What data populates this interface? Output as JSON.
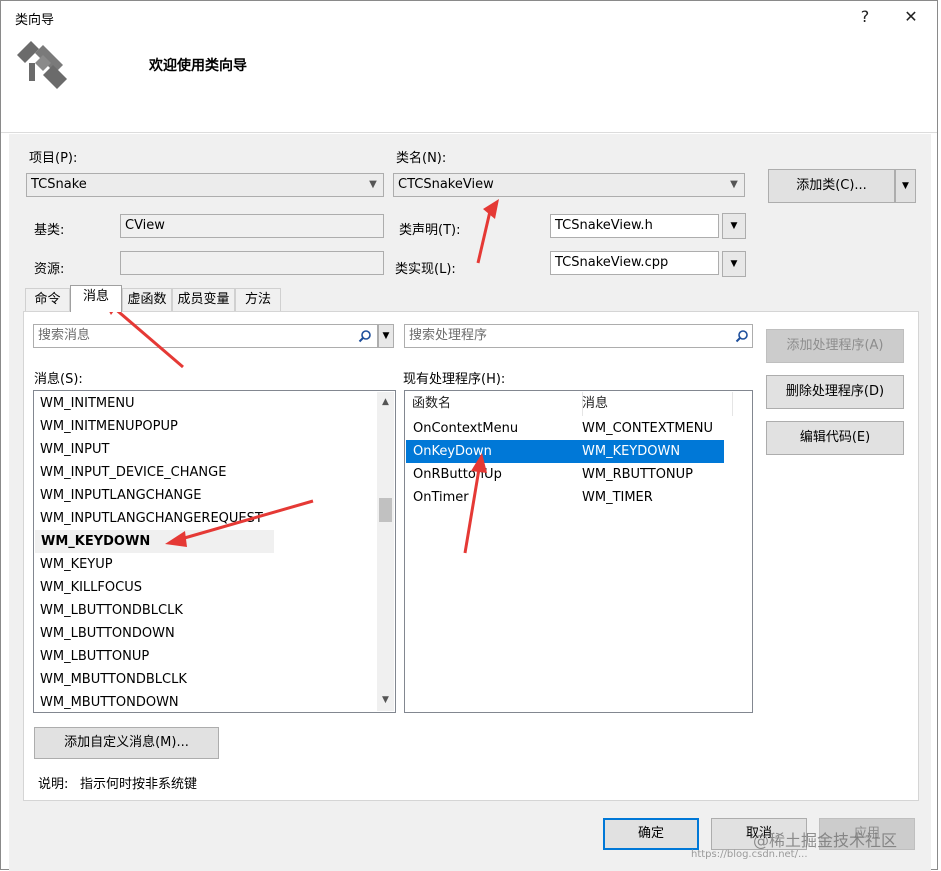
{
  "dialog": {
    "title": "类向导",
    "help_glyph": "?",
    "close_glyph": "✕",
    "welcome": "欢迎使用类向导"
  },
  "fields": {
    "project_label": "项目(P):",
    "project_value": "TCSnake",
    "classname_label": "类名(N):",
    "classname_value": "CTCSnakeView",
    "add_class_label": "添加类(C)...",
    "base_label": "基类:",
    "base_value": "CView",
    "resource_label": "资源:",
    "resource_value": "",
    "decl_label": "类声明(T):",
    "decl_value": "TCSnakeView.h",
    "impl_label": "类实现(L):",
    "impl_value": "TCSnakeView.cpp"
  },
  "tabs": [
    {
      "label": "命令"
    },
    {
      "label": "消息"
    },
    {
      "label": "虚函数"
    },
    {
      "label": "成员变量"
    },
    {
      "label": "方法"
    }
  ],
  "messages_panel": {
    "search_placeholder": "搜索消息",
    "list_label": "消息(S):",
    "items": [
      "WM_INITMENU",
      "WM_INITMENUPOPUP",
      "WM_INPUT",
      "WM_INPUT_DEVICE_CHANGE",
      "WM_INPUTLANGCHANGE",
      "WM_INPUTLANGCHANGEREQUEST",
      "WM_KEYDOWN",
      "WM_KEYUP",
      "WM_KILLFOCUS",
      "WM_LBUTTONDBLCLK",
      "WM_LBUTTONDOWN",
      "WM_LBUTTONUP",
      "WM_MBUTTONDBLCLK",
      "WM_MBUTTONDOWN"
    ],
    "selected_index": 6,
    "add_custom_label": "添加自定义消息(M)..."
  },
  "handlers_panel": {
    "search_placeholder": "搜索处理程序",
    "list_label": "现有处理程序(H):",
    "col_func": "函数名",
    "col_msg": "消息",
    "rows": [
      {
        "func": "OnContextMenu",
        "msg": "WM_CONTEXTMENU"
      },
      {
        "func": "OnKeyDown",
        "msg": "WM_KEYDOWN"
      },
      {
        "func": "OnRButtonUp",
        "msg": "WM_RBUTTONUP"
      },
      {
        "func": "OnTimer",
        "msg": "WM_TIMER"
      }
    ],
    "selected_index": 1
  },
  "side_buttons": {
    "add_handler": "添加处理程序(A)",
    "delete_handler": "删除处理程序(D)",
    "edit_code": "编辑代码(E)"
  },
  "description": {
    "label": "说明:",
    "text": "指示何时按非系统键"
  },
  "footer": {
    "ok": "确定",
    "cancel": "取消",
    "apply": "应用"
  },
  "watermark": {
    "text": "@稀土掘金技术社区",
    "url": "https://blog.csdn.net/..."
  },
  "colors": {
    "selection": "#0078d7",
    "annotation_arrow": "#e53935"
  }
}
